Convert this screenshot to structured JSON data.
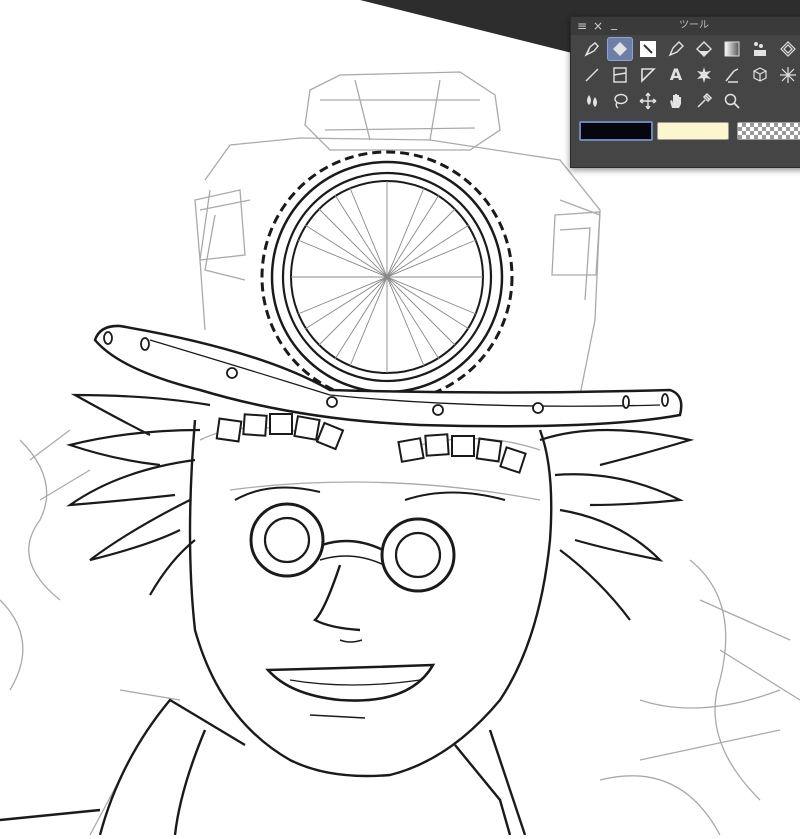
{
  "palette": {
    "title": "ツール",
    "menu_icon": "hamburger-icon",
    "close_glyph": "×",
    "minimize_glyph": "_",
    "tools": [
      {
        "icon": "pen-nib-icon"
      },
      {
        "icon": "eraser-icon",
        "active": true
      },
      {
        "icon": "brush-icon"
      },
      {
        "icon": "fountain-pen-icon"
      },
      {
        "icon": "fill-bucket-icon"
      },
      {
        "icon": "gradient-icon"
      },
      {
        "icon": "decoration-icon"
      },
      {
        "icon": "pattern-icon"
      },
      {
        "icon": "line-icon"
      },
      {
        "icon": "frame-icon"
      },
      {
        "icon": "ruler-icon"
      },
      {
        "icon": "text-tool-icon",
        "glyph": "A"
      },
      {
        "icon": "balloon-burst-icon"
      },
      {
        "icon": "correct-line-icon"
      },
      {
        "icon": "3d-object-icon"
      },
      {
        "icon": "sparkle-icon"
      },
      {
        "icon": "blend-icon"
      },
      {
        "icon": "lasso-icon"
      },
      {
        "icon": "move-icon"
      },
      {
        "icon": "hand-icon"
      },
      {
        "icon": "eyedropper-icon"
      },
      {
        "icon": "zoom-icon"
      }
    ],
    "colors": {
      "foreground": "#06060f",
      "background": "#fcf6cf",
      "transparent": "checker"
    }
  },
  "canvas": {
    "corner_color": "#2d2d2d",
    "paper_color": "#ffffff"
  }
}
